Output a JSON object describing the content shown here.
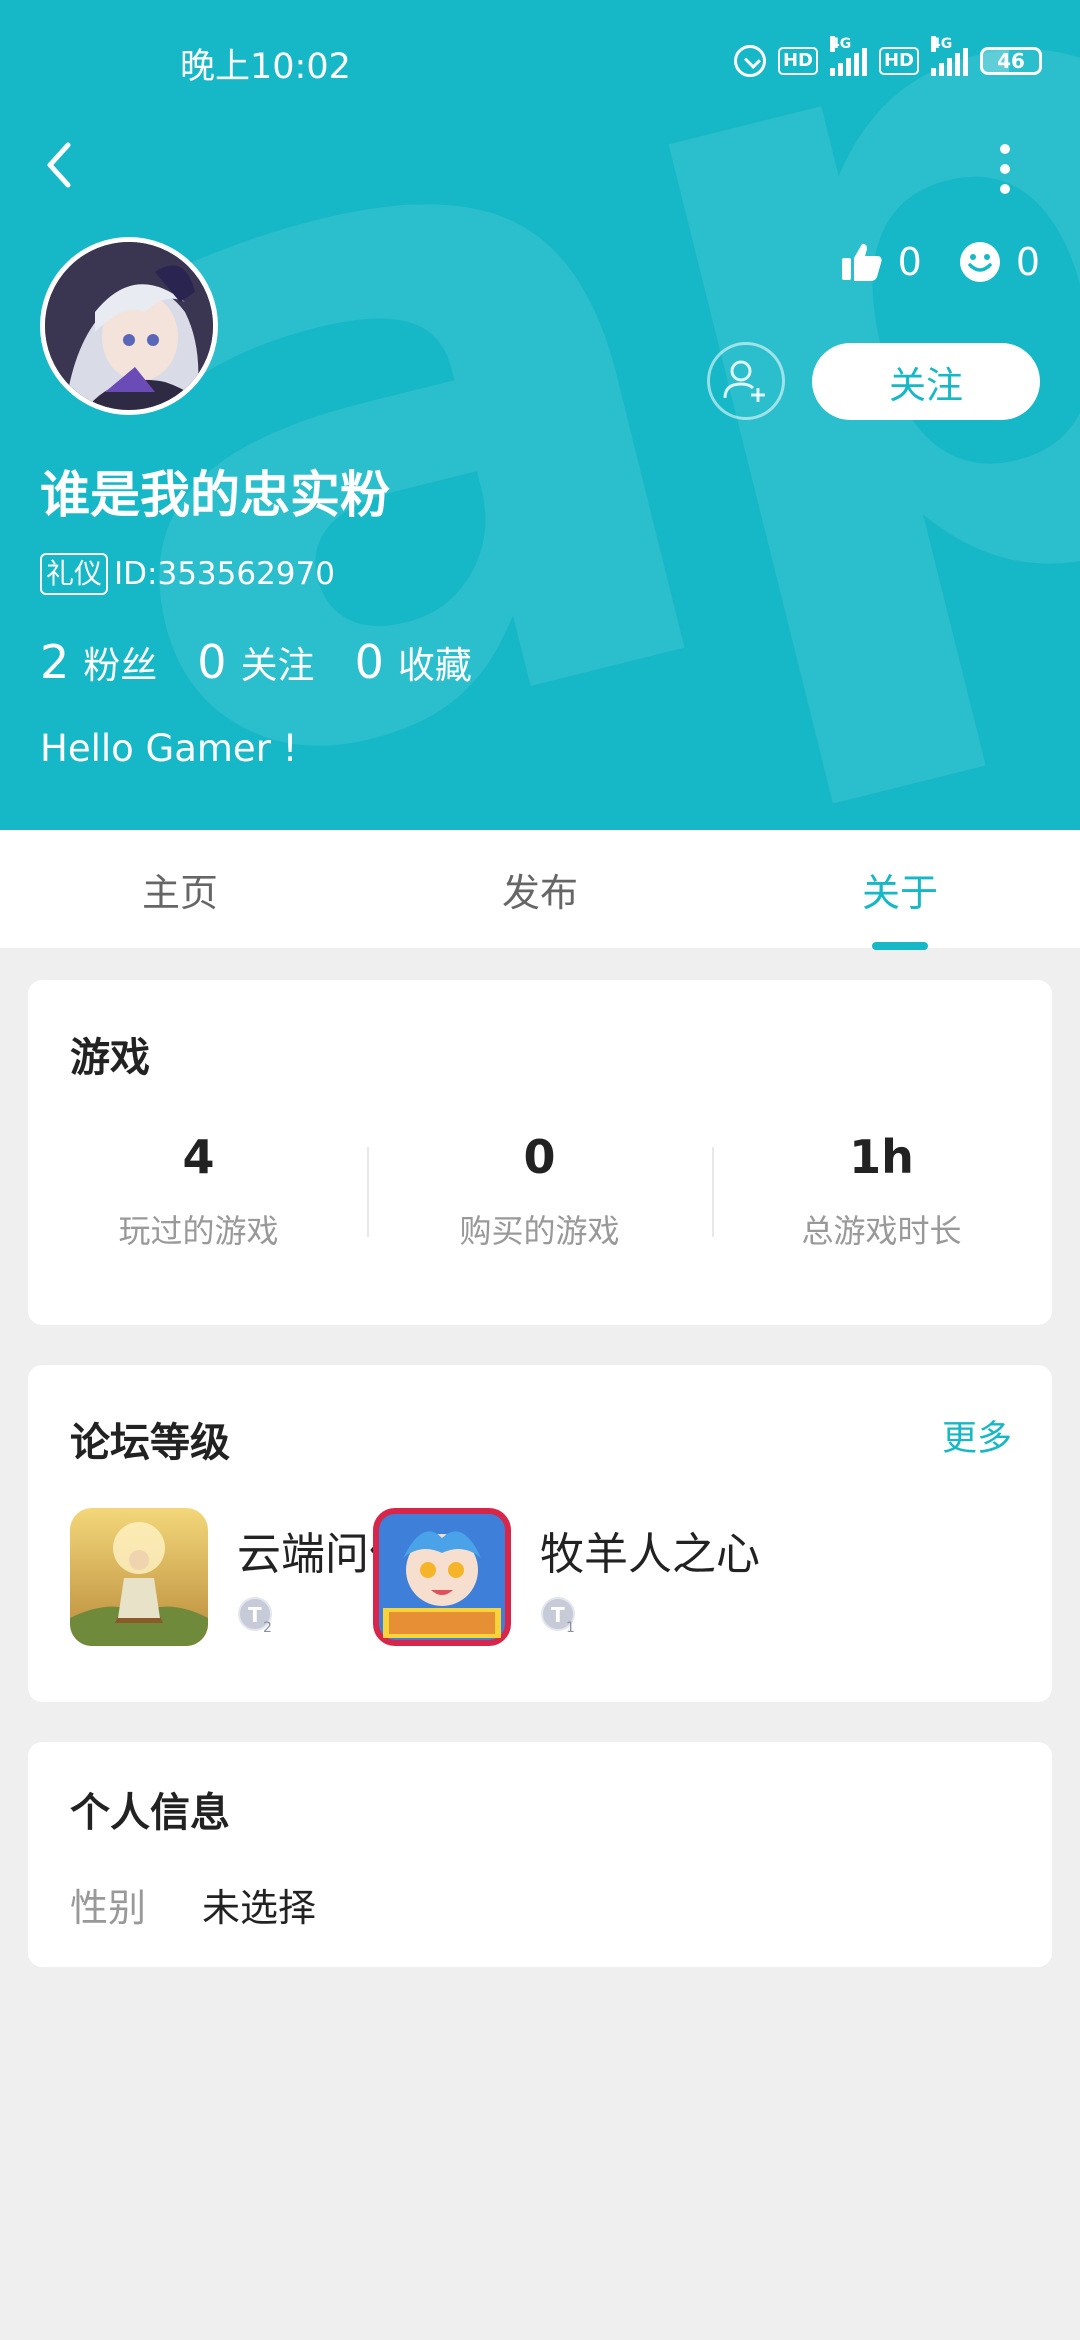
{
  "status_bar": {
    "time": "晚上10:02",
    "hd1": "HD",
    "net1": "4G",
    "hd2": "HD",
    "net2": "4G",
    "battery": "46",
    "battery_level": 0.46
  },
  "profile": {
    "likes": "0",
    "smiles": "0",
    "follow_label": "关注",
    "username": "谁是我的忠实粉",
    "badge": "礼仪",
    "user_id": "ID:353562970",
    "counts": [
      {
        "num": "2",
        "label": "粉丝"
      },
      {
        "num": "0",
        "label": "关注"
      },
      {
        "num": "0",
        "label": "收藏"
      }
    ],
    "bio": "Hello Gamer !"
  },
  "tabs": [
    {
      "label": "主页"
    },
    {
      "label": "发布"
    },
    {
      "label": "关于"
    }
  ],
  "games": {
    "title": "游戏",
    "stats": [
      {
        "num": "4",
        "label": "玩过的游戏"
      },
      {
        "num": "0",
        "label": "购买的游戏"
      },
      {
        "num": "1h",
        "label": "总游戏时长"
      }
    ]
  },
  "forum": {
    "title": "论坛等级",
    "more": "更多",
    "items": [
      {
        "name": "云端问仙",
        "level": "2"
      },
      {
        "name": "牧羊人之心",
        "level": "1"
      }
    ]
  },
  "personal": {
    "title": "个人信息",
    "gender_key": "性别",
    "gender_val": "未选择"
  },
  "colors": {
    "accent": "#16b8c7",
    "background": "#efefef"
  }
}
